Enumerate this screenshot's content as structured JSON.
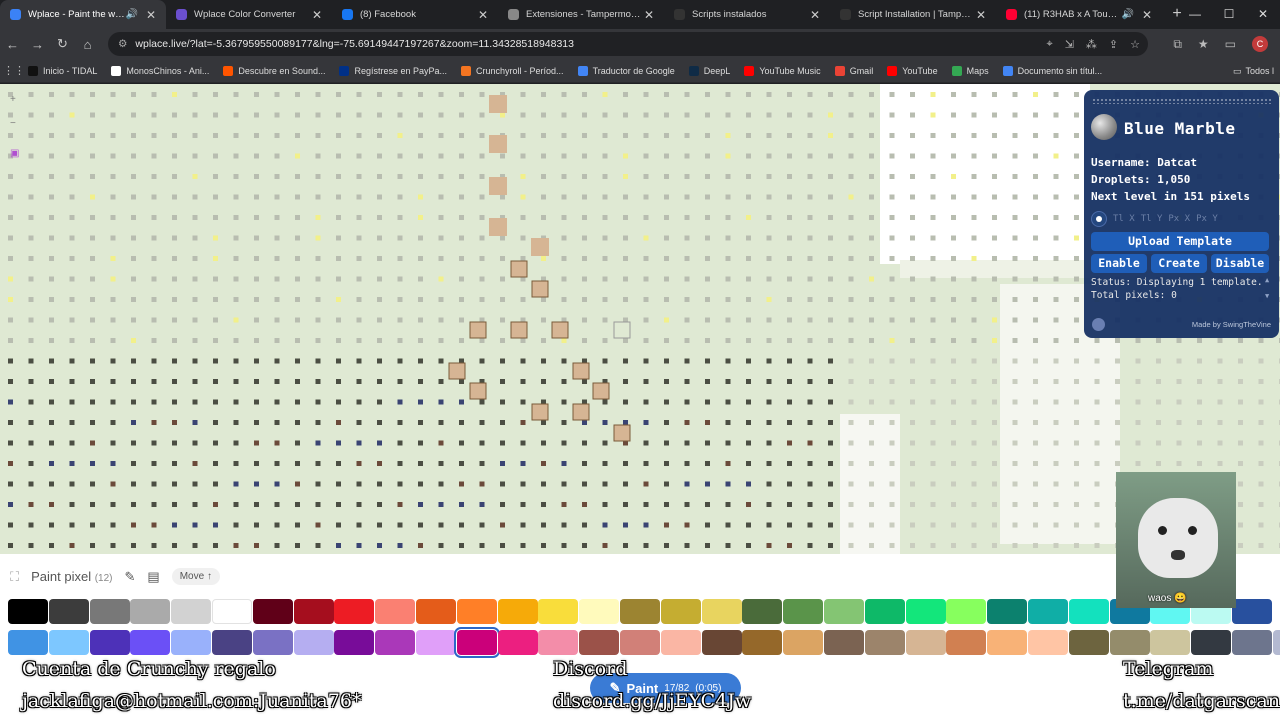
{
  "browser": {
    "tabs": [
      {
        "title": "Wplace - Paint the world",
        "color": "#3b82f6",
        "active": true,
        "audio": true
      },
      {
        "title": "Wplace Color Converter",
        "color": "#6b4fcf",
        "active": false,
        "audio": false
      },
      {
        "title": "(8) Facebook",
        "color": "#1877f2",
        "active": false,
        "audio": false
      },
      {
        "title": "Extensiones - Tampermonkey",
        "color": "#888888",
        "active": false,
        "audio": false
      },
      {
        "title": "Scripts instalados",
        "color": "#333333",
        "active": false,
        "audio": false
      },
      {
        "title": "Script Installation | Tampermonkey",
        "color": "#333333",
        "active": false,
        "audio": false
      },
      {
        "title": "(11) R3HAB x A Touch Of Cl",
        "color": "#ff0033",
        "active": false,
        "audio": true
      }
    ],
    "url": "wplace.live/?lat=-5.367959550089177&lng=-75.69149447197267&zoom=11.34328518948313",
    "profile_initial": "C",
    "bookmarks": [
      {
        "label": "Inicio - TIDAL",
        "color": "#111111"
      },
      {
        "label": "MonosChinos - Ani...",
        "color": "#ffffff"
      },
      {
        "label": "Descubre en Sound...",
        "color": "#ff5500"
      },
      {
        "label": "Regístrese en PayPa...",
        "color": "#003087"
      },
      {
        "label": "Crunchyroll - Períod...",
        "color": "#f47521"
      },
      {
        "label": "Traductor de Google",
        "color": "#4285f4"
      },
      {
        "label": "DeepL",
        "color": "#0f2b46"
      },
      {
        "label": "YouTube Music",
        "color": "#ff0000"
      },
      {
        "label": "Gmail",
        "color": "#ea4335"
      },
      {
        "label": "YouTube",
        "color": "#ff0000"
      },
      {
        "label": "Maps",
        "color": "#34a853"
      },
      {
        "label": "Documento sin títul...",
        "color": "#4285f4"
      }
    ],
    "bookmarks_folder": "Todos l"
  },
  "blue_marble": {
    "title": "Blue Marble",
    "username_label": "Username:",
    "username": "Datcat",
    "droplets_label": "Droplets:",
    "droplets": "1,050",
    "level_prefix": "Next level in",
    "level_pixels": "151",
    "level_suffix": "pixels",
    "coord_placeholders": [
      "Tl X",
      "Tl Y",
      "Px X",
      "Px Y"
    ],
    "upload_label": "Upload Template",
    "enable_label": "Enable",
    "create_label": "Create",
    "disable_label": "Disable",
    "status_text": "Status: Displaying 1 template.\nTotal pixels: 0",
    "credit": "Made by SwingTheVine"
  },
  "paint_panel": {
    "title": "Paint pixel",
    "count": "(12)",
    "move_label": "Move ↑",
    "paint_label": "Paint",
    "paint_progress": "17/82",
    "paint_timer": "(0:05)",
    "selected_color_index": 42,
    "colors": [
      "#000000",
      "#3c3c3c",
      "#787878",
      "#aaaaaa",
      "#d2d2d2",
      "#ffffff",
      "#600018",
      "#a50e1e",
      "#ed1c24",
      "#fa8072",
      "#e45c1a",
      "#ff7f27",
      "#f6aa09",
      "#f9dd3b",
      "#fffabc",
      "#9c8431",
      "#c5ad31",
      "#e8d45f",
      "#4a6b3a",
      "#5a944a",
      "#84c573",
      "#0eb968",
      "#13e67b",
      "#87ff5e",
      "#0c816e",
      "#10aea6",
      "#13e1be",
      "#0f799f",
      "#60f7f2",
      "#bbfaf2",
      "#28509e",
      "#4093e4",
      "#7dc7ff",
      "#4d31b8",
      "#6b50f6",
      "#99b1fb",
      "#4a4284",
      "#7a71c4",
      "#b5aef1",
      "#780c99",
      "#aa38b9",
      "#e09ff9",
      "#cb007a",
      "#ec1f80",
      "#f38da9",
      "#9b5249",
      "#d18078",
      "#fab6a4",
      "#684634",
      "#95682a",
      "#dba463",
      "#7b6352",
      "#9c846b",
      "#d6b594",
      "#d18051",
      "#f8b277",
      "#ffc5a5",
      "#6d643f",
      "#948c6b",
      "#cdc59e",
      "#333941",
      "#6d758d",
      "#b3b9d1"
    ]
  },
  "overlay": {
    "crunchy_line1": "Cuenta de Crunchy regalo",
    "crunchy_line2": "jacklafiga@hotmail.com:Juanita76*",
    "discord_line1": "Discord",
    "discord_line2": "discord.gg/JjEYC4Jw",
    "telegram_line1": "Telegram",
    "telegram_line2": "t.me/datgarscan",
    "cam_caption": "waos 😀"
  }
}
